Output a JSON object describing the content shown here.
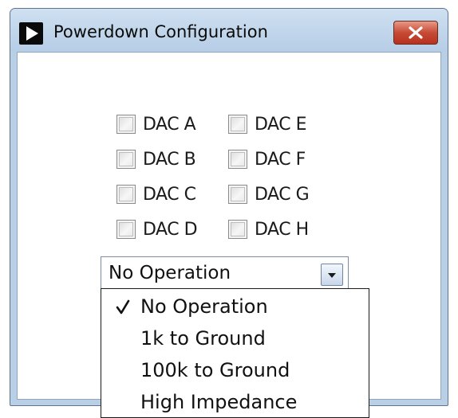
{
  "window": {
    "title": "Powerdown Configuration"
  },
  "checkboxes": [
    {
      "label": "DAC A",
      "checked": false
    },
    {
      "label": "DAC E",
      "checked": false
    },
    {
      "label": "DAC B",
      "checked": false
    },
    {
      "label": "DAC F",
      "checked": false
    },
    {
      "label": "DAC C",
      "checked": false
    },
    {
      "label": "DAC G",
      "checked": false
    },
    {
      "label": "DAC D",
      "checked": false
    },
    {
      "label": "DAC H",
      "checked": false
    }
  ],
  "mode_select": {
    "value": "No Operation",
    "options": [
      {
        "label": "No Operation",
        "selected": true
      },
      {
        "label": "1k to Ground",
        "selected": false
      },
      {
        "label": "100k to Ground",
        "selected": false
      },
      {
        "label": "High Impedance",
        "selected": false
      }
    ]
  },
  "colors": {
    "titlebar": "#b9cfe6",
    "close_button": "#c64a35",
    "dropdown_border": "#1a1a1a"
  },
  "icons": {
    "app": "play-triangle-icon",
    "close": "close-x-icon",
    "combo_arrow": "chevron-down-icon",
    "selected_option": "checkmark-icon"
  }
}
